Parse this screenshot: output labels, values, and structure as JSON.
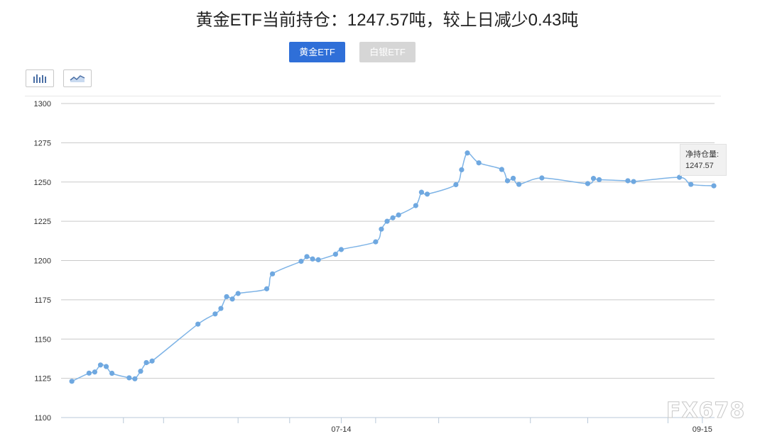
{
  "header": {
    "title": "黄金ETF当前持仓：1247.57吨，较上日减少0.43吨"
  },
  "tabs": [
    {
      "label": "黄金ETF",
      "active": true
    },
    {
      "label": "白银ETF",
      "active": false
    }
  ],
  "view_buttons": [
    {
      "icon": "bar-chart-icon"
    },
    {
      "icon": "line-chart-icon"
    }
  ],
  "tooltip": {
    "label": "净持仓量:",
    "value": "1247.57"
  },
  "watermark": "FX678",
  "colors": {
    "line": "#7db3e6",
    "point": "#6fa8e0",
    "grid": "#c9c9c9",
    "tab_active": "#2f6fd8",
    "tab_inactive": "#d6d6d6"
  },
  "chart_data": {
    "type": "line",
    "ylim": [
      1100,
      1300
    ],
    "yticks": [
      1100,
      1125,
      1150,
      1175,
      1200,
      1225,
      1250,
      1275,
      1300
    ],
    "xtick_labels": [
      {
        "day": 47,
        "label": "07-14"
      },
      {
        "day": 110,
        "label": "09-15"
      }
    ],
    "x_minor_ticks_days": [
      9,
      16,
      29,
      38,
      53,
      64,
      80,
      90,
      104
    ],
    "x_range_days": [
      -2,
      112
    ],
    "series": [
      {
        "values": [
          [
            0,
            1123.1
          ],
          [
            3,
            1128.3
          ],
          [
            4,
            1129.0
          ],
          [
            5,
            1133.5
          ],
          [
            6,
            1132.5
          ],
          [
            7,
            1128.2
          ],
          [
            10,
            1125.3
          ],
          [
            11,
            1124.7
          ],
          [
            12,
            1129.5
          ],
          [
            13,
            1135.0
          ],
          [
            14,
            1136.0
          ],
          [
            22,
            1159.5
          ],
          [
            25,
            1166.0
          ],
          [
            26,
            1169.5
          ],
          [
            27,
            1177.0
          ],
          [
            28,
            1175.5
          ],
          [
            29,
            1179.0
          ],
          [
            34,
            1182.0
          ],
          [
            35,
            1191.5
          ],
          [
            40,
            1199.5
          ],
          [
            41,
            1202.5
          ],
          [
            42,
            1201.0
          ],
          [
            43,
            1200.5
          ],
          [
            46,
            1204.0
          ],
          [
            47,
            1207.0
          ],
          [
            53,
            1211.9
          ],
          [
            54,
            1220.0
          ],
          [
            55,
            1225.0
          ],
          [
            56,
            1227.2
          ],
          [
            57,
            1229.0
          ],
          [
            60,
            1235.0
          ],
          [
            61,
            1243.5
          ],
          [
            62,
            1242.3
          ],
          [
            67,
            1248.3
          ],
          [
            68,
            1257.8
          ],
          [
            69,
            1268.5
          ],
          [
            71,
            1262.2
          ],
          [
            75,
            1258.0
          ],
          [
            76,
            1250.8
          ],
          [
            77,
            1252.4
          ],
          [
            78,
            1248.5
          ],
          [
            82,
            1252.6
          ],
          [
            90,
            1249.0
          ],
          [
            91,
            1252.3
          ],
          [
            92,
            1251.5
          ],
          [
            97,
            1250.8
          ],
          [
            98,
            1250.3
          ],
          [
            106,
            1253.0
          ],
          [
            108,
            1248.5
          ],
          [
            112,
            1247.57
          ]
        ]
      }
    ]
  }
}
